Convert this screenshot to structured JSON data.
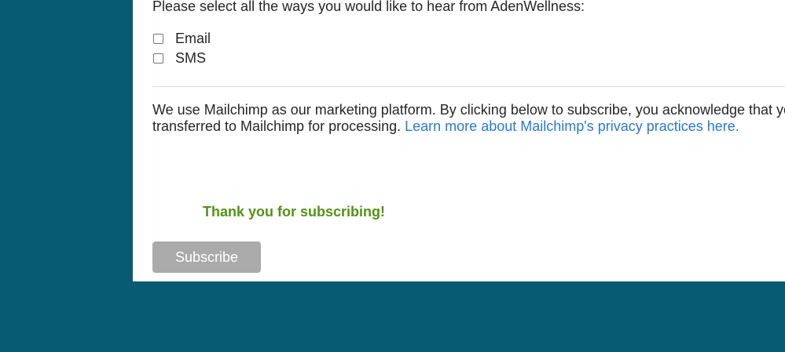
{
  "signup_form": {
    "contact_prompt": "Please select all the ways you would like to hear from AdenWellness:",
    "options": [
      {
        "label": "Email",
        "checked": false
      },
      {
        "label": "SMS",
        "checked": false
      }
    ],
    "disclaimer": {
      "line_1": "We use Mailchimp as our marketing platform. By clicking below to subscribe, you acknowledge that your",
      "line_2_text": "transferred to Mailchimp for processing.",
      "privacy_link": "Learn more about Mailchimp's privacy practices here."
    },
    "success_message": "Thank you for subscribing!",
    "subscribe_label": "Subscribe"
  },
  "colors": {
    "background": "#075b72",
    "panel": "#ffffff",
    "text": "#262626",
    "link": "#2978d6",
    "success": "#529214",
    "button": "#aaaaaa"
  },
  "icons": {
    "option_checkbox": "checkbox-unchecked-icon"
  }
}
